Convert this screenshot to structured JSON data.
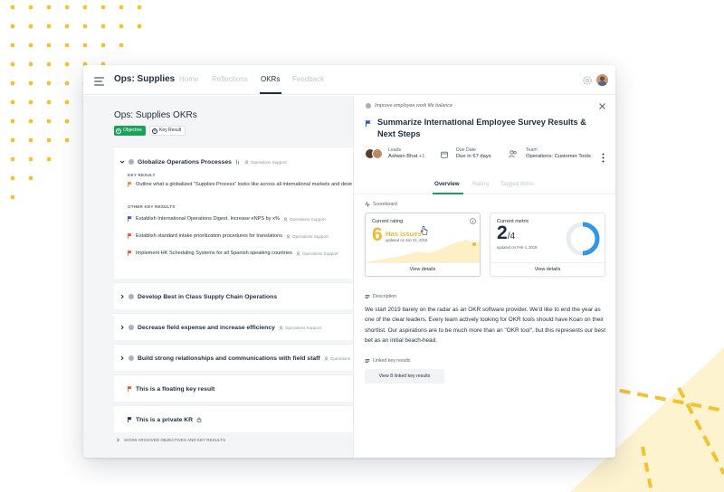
{
  "header": {
    "title": "Ops: Supplies",
    "nav": [
      "Home",
      "Reflections",
      "OKRs",
      "Feedback"
    ],
    "active_nav": "OKRs"
  },
  "left": {
    "page_title": "Ops: Supplies OKRs",
    "buttons": {
      "objective": "Objective",
      "key_result": "Key Result"
    },
    "objectives": [
      {
        "title": "Globalize Operations Processes",
        "team": "Operations Support",
        "key_result_label": "KEY RESULT",
        "key_results": [
          {
            "text": "Outline what a globalized \"Supplies Process\" looks like across all international markets and deve"
          }
        ],
        "other_label": "OTHER KEY RESULTS",
        "other_key_results": [
          {
            "text": "Establish International Operations Digest. Increase eNPS by x%",
            "team": "Operations Support",
            "flag": "blue"
          },
          {
            "text": "Establish standard intake prioritization procedures for translations",
            "team": "Operations Support",
            "flag": "red"
          },
          {
            "text": "Implement HK Scheduling Systems for all Spanish speaking countries",
            "team": "Operations Support",
            "flag": "red"
          }
        ]
      },
      {
        "title": "Develop Best in Class Supply Chain Operations",
        "team": ""
      },
      {
        "title": "Decrease field expense and increase efficiency",
        "team": "Operations Support"
      },
      {
        "title": "Build strong relationships and communications with field staff",
        "team": "Operations"
      }
    ],
    "floating_kr": "This is a floating key result",
    "private_kr": "This is a private KR",
    "archived_label": "SHOW ARCHIVED OBJECTIVES AND KEY RESULTS"
  },
  "right": {
    "breadcrumb": "Improve employee work life balance",
    "title": "Summarize International Employee Survey Results & Next Steps",
    "leads": {
      "label": "Leads",
      "value": "Ashwin Bhat",
      "more": "+1"
    },
    "due": {
      "label": "Due Date",
      "value": "Due in 67 days"
    },
    "team": {
      "label": "Team",
      "value": "Operations: Customer Tools"
    },
    "tabs": [
      "Overview",
      "Rating",
      "Tagged items"
    ],
    "active_tab": "Overview",
    "scoreboard_label": "Scoreboard",
    "current_rating": {
      "label": "Current rating",
      "value": "6",
      "status": "Has issues",
      "updated": "updated on Jan 31, 2018",
      "action": "View details"
    },
    "current_metric": {
      "label": "Current metric",
      "value": "2",
      "total": "/4",
      "progress": 0.5,
      "updated": "updated on Feb 4, 2018",
      "action": "View details"
    },
    "description_label": "Description",
    "description": "We start 2019 barely on the radar as an OKR software provider. We'd like to end the year as one of the clear leaders. Every team actively looking for OKR tools should have Koan on their shortlist. Our aspirations are to be much more than an \"OKR tool\", but this represents our best bet as an initial beach-head.",
    "linked_label": "Linked key results",
    "linked_button": "View 8 linked key results"
  },
  "colors": {
    "green": "#1aa05a",
    "yellow": "#f0b82c",
    "blue_flag": "#2f56c8",
    "red_flag": "#e8552f",
    "metric_blue": "#2f96e8"
  }
}
